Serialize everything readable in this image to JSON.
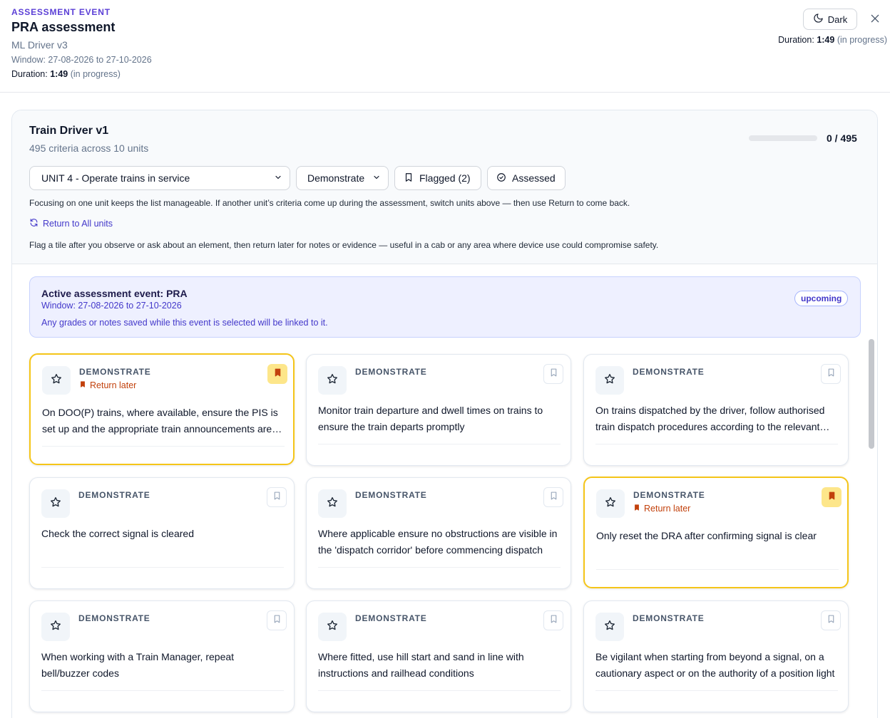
{
  "header": {
    "eyebrow": "ASSESSMENT EVENT",
    "title": "PRA assessment",
    "subtitle": "ML Driver v3",
    "window": "Window: 27-08-2026 to 27-10-2026",
    "duration_label": "Duration:",
    "duration_value": "1:49",
    "duration_status": "(in progress)",
    "theme_button_label": "Dark"
  },
  "panel": {
    "title": "Train Driver v1",
    "subtitle": "495 criteria across 10 units",
    "progress_text": "0 / 495",
    "progress_fraction": 0,
    "unit_select_value": "UNIT 4 - Operate trains in service",
    "mode_select_value": "Demonstrate",
    "flagged_label": "Flagged (2)",
    "assessed_label": "Assessed",
    "helper_text": "Focusing on one unit keeps the list manageable. If another unit’s criteria come up during the assessment, switch units above — then use Return to come back.",
    "return_link": "Return to All units",
    "flag_note": "Flag a tile after you observe or ask about an element, then return later for notes or evidence — useful in a cab or any area where device use could compromise safety."
  },
  "event_banner": {
    "title": "Active assessment event: PRA",
    "window": "Window: 27-08-2026 to 27-10-2026",
    "note": "Any grades or notes saved while this event is selected will be linked to it.",
    "badge": "upcoming"
  },
  "tiles": [
    {
      "type": "DEMONSTRATE",
      "flagged": true,
      "return_label": "Return later",
      "text": "On DOO(P) trains, where available, ensure the PIS is set up and the appropriate train announcements are made"
    },
    {
      "type": "DEMONSTRATE",
      "flagged": false,
      "return_label": "",
      "text": "Monitor train departure and dwell times on trains to ensure the train departs promptly"
    },
    {
      "type": "DEMONSTRATE",
      "flagged": false,
      "return_label": "",
      "text": "On trains dispatched by the driver, follow authorised train dispatch procedures according to the relevant instructions"
    },
    {
      "type": "DEMONSTRATE",
      "flagged": false,
      "return_label": "",
      "text": "Check the correct signal is cleared"
    },
    {
      "type": "DEMONSTRATE",
      "flagged": false,
      "return_label": "",
      "text": "Where applicable ensure no obstructions are visible in the 'dispatch corridor' before commencing dispatch"
    },
    {
      "type": "DEMONSTRATE",
      "flagged": true,
      "return_label": "Return later",
      "text": "Only reset the DRA after confirming signal is clear"
    },
    {
      "type": "DEMONSTRATE",
      "flagged": false,
      "return_label": "",
      "text": "When working with a Train Manager, repeat bell/buzzer codes"
    },
    {
      "type": "DEMONSTRATE",
      "flagged": false,
      "return_label": "",
      "text": "Where fitted, use hill start and sand in line with instructions and railhead conditions"
    },
    {
      "type": "DEMONSTRATE",
      "flagged": false,
      "return_label": "",
      "text": "Be vigilant when starting from beyond a signal, on a cautionary aspect or on the authority of a position light"
    }
  ],
  "icons": {
    "theme": "moon-icon",
    "close": "close-icon",
    "select": "chevron-down-icon",
    "flagged": "bookmark-icon",
    "assessed": "check-circle-icon",
    "return": "refresh-icon",
    "tile_rating": "star-icon"
  },
  "colors": {
    "accent": "#5b3fd6",
    "link": "#4338ca",
    "flag_border": "#f5c518",
    "flag_fill": "#fde68a",
    "return_later": "#c2410c"
  }
}
